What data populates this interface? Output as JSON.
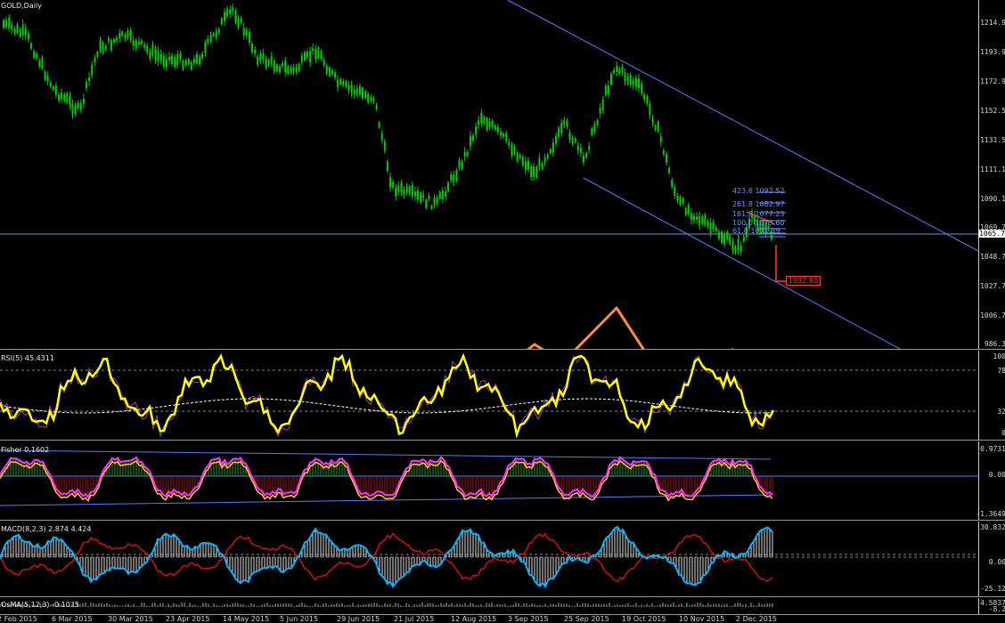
{
  "colors": {
    "background": "#000000",
    "candle": "#00d000",
    "rsi": "#ffff00",
    "channel": "#4f7bff",
    "arrow": "#ff8a3d",
    "macd": "#00b4ff",
    "signal": "#d01010",
    "fib": "#6c8cff",
    "target": "#ff3b3b"
  },
  "chart": {
    "symbol_title": "GOLD,Daily",
    "current_price": "1065.7",
    "target_price": "1032.80",
    "price_axis": [
      "1214.9",
      "1193.9",
      "1172.9",
      "1152.5",
      "1131.5",
      "1111.1",
      "1090.1",
      "1069.7",
      "1048.7",
      "1027.7",
      "1006.7",
      "986.3"
    ],
    "fib_labels": [
      "423.6 1092.52",
      "261.8 1082.97",
      "161.8 1077.23",
      "100.0 1073.60",
      "61.8 1071.39"
    ]
  },
  "rsi": {
    "title": "RSI(5) 45.4311",
    "axis": [
      "100",
      "78",
      "32",
      "0"
    ]
  },
  "fisher": {
    "title": "Fisher 0.1602",
    "axis": [
      "0.9731",
      "0.00",
      "-1.3649"
    ]
  },
  "macd": {
    "title": "MACD(8,2,3) 2.874 4.424",
    "axis": [
      "30.832",
      "0.00",
      "-25.12"
    ]
  },
  "osma": {
    "title": "OsMA(5,12,3) -0.1035",
    "axis": [
      "4.5837",
      "-8.2"
    ]
  },
  "time_axis": [
    "2 Feb 2015",
    "6 Mar 2015",
    "30 Mar 2015",
    "23 Apr 2015",
    "14 May 2015",
    "5 Jun 2015",
    "29 Jun 2015",
    "21 Jul 2015",
    "12 Aug 2015",
    "3 Sep 2015",
    "25 Sep 2015",
    "19 Oct 2015",
    "10 Nov 2015",
    "2 Dec 2015"
  ],
  "chart_data": {
    "type": "candlestick",
    "title": "GOLD,Daily",
    "x_range": [
      "2 Feb 2015",
      "2 Dec 2015"
    ],
    "y_range": [
      986.3,
      1225
    ],
    "close_path": [
      {
        "date": "2 Feb 2015",
        "price": 1220
      },
      {
        "date": "6 Mar 2015",
        "price": 1155
      },
      {
        "date": "20 Mar 2015",
        "price": 1205
      },
      {
        "date": "30 Mar 2015",
        "price": 1210
      },
      {
        "date": "23 Apr 2015",
        "price": 1190
      },
      {
        "date": "14 May 2015",
        "price": 1222
      },
      {
        "date": "5 Jun 2015",
        "price": 1175
      },
      {
        "date": "29 Jun 2015",
        "price": 1180
      },
      {
        "date": "21 Jul 2015",
        "price": 1090
      },
      {
        "date": "12 Aug 2015",
        "price": 1120
      },
      {
        "date": "3 Sep 2015",
        "price": 1125
      },
      {
        "date": "25 Sep 2015",
        "price": 1150
      },
      {
        "date": "19 Oct 2015",
        "price": 1180
      },
      {
        "date": "10 Nov 2015",
        "price": 1085
      },
      {
        "date": "2 Dec 2015",
        "price": 1065.7
      }
    ],
    "annotations": {
      "target": 1032.8,
      "current": 1065.7
    }
  }
}
